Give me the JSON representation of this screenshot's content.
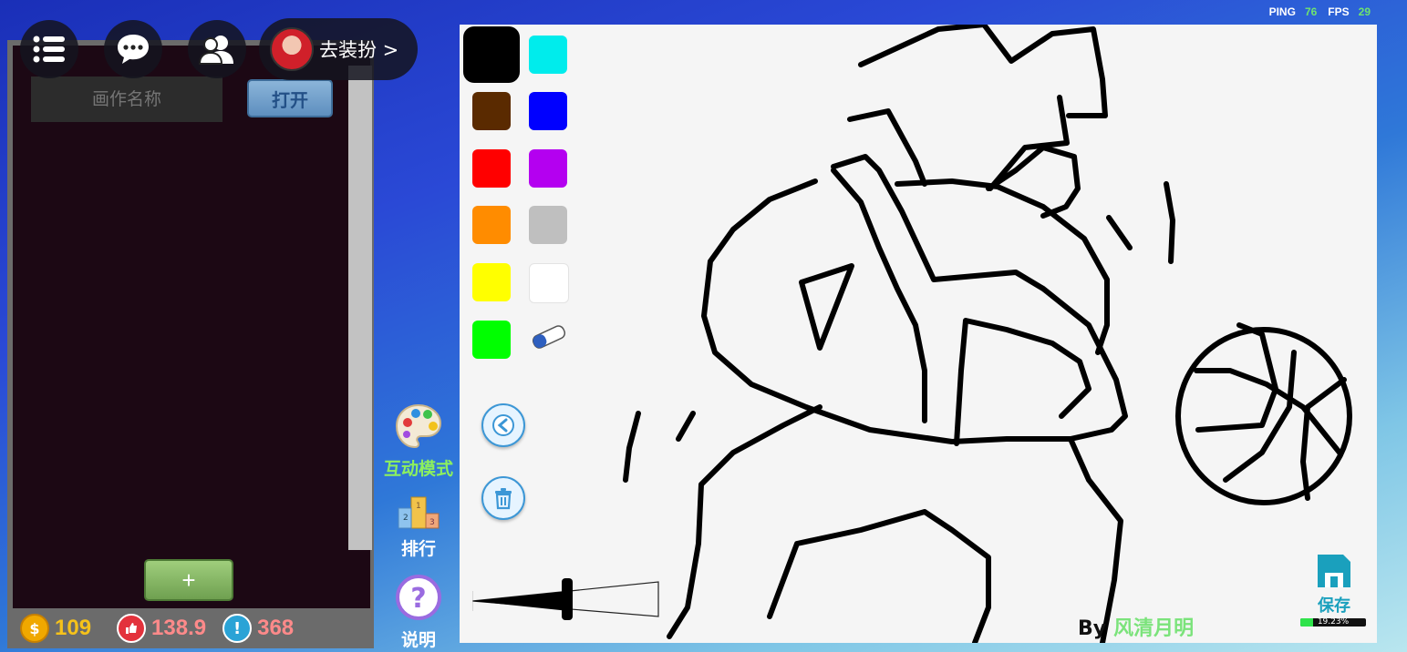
{
  "stats": {
    "ping_label": "PING",
    "ping_value": "76",
    "fps_label": "FPS",
    "fps_value": "29"
  },
  "toolbar": {
    "dress_label": "去装扮 >"
  },
  "left_panel": {
    "name_placeholder": "画作名称",
    "open_label": "打开",
    "add_label": "+",
    "coins": "109",
    "likes": "138.9",
    "alerts": "368"
  },
  "side_modes": [
    {
      "label": "互动模式",
      "color": "#8df05e",
      "icon": "palette-icon"
    },
    {
      "label": "排行",
      "color": "#ffffff",
      "icon": "podium-icon"
    },
    {
      "label": "说明",
      "color": "#ffffff",
      "icon": "help-icon"
    }
  ],
  "palette": {
    "colors": [
      "#000000",
      "#00ecec",
      "#5a2a00",
      "#0000ff",
      "#ff0000",
      "#b400f0",
      "#ff8c00",
      "#bfbfbf",
      "#ffff00",
      "#ffffff",
      "#00ff00"
    ],
    "selected": "#000000"
  },
  "canvas": {
    "by_label": "By",
    "author": "风清月明",
    "save_label": "保存",
    "progress_text": "19.23%",
    "progress_value": 19.23
  }
}
